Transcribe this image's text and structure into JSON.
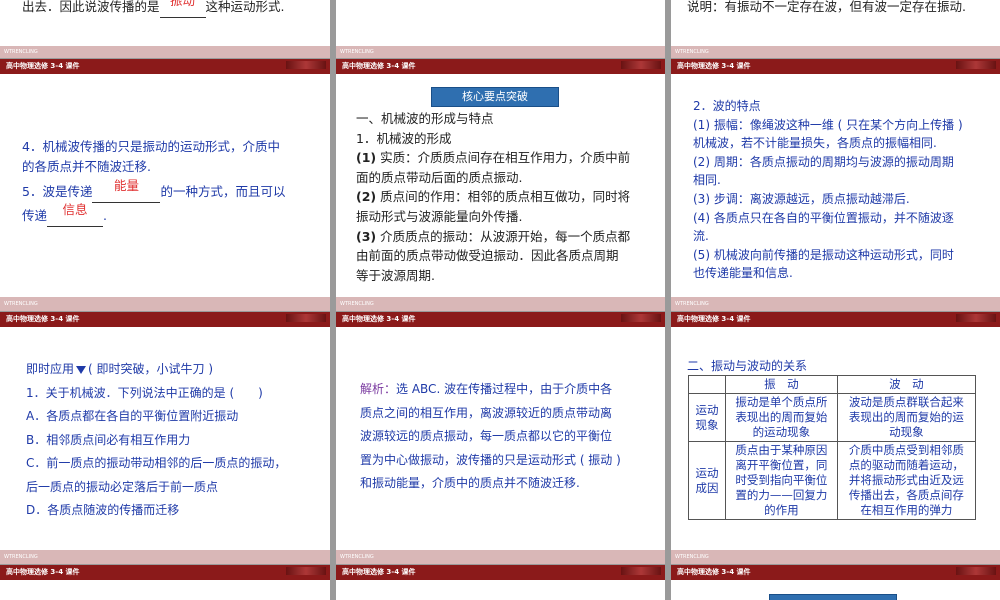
{
  "header_label": "高中物理选修 3-4 课件",
  "strip_label": "WTRENCLING",
  "top_row": {
    "left": {
      "before": "出去．因此说波传播的是",
      "blank": "振动",
      "after": "这种运动形式."
    },
    "right": "说明：有振动不一定存在波，但有波一定存在振动."
  },
  "row2": {
    "left": {
      "item4": "4．机械波传播的只是振动的运动形式，介质中的各质点并不随波迁移.",
      "item4_line1": "4．机械波传播的只是振动的运动形式，介质中",
      "item4_line2": "的各质点并不随波迁移.",
      "item5_before": "5．波是传递",
      "item5_blank1": "能量",
      "item5_mid": "的一种方式，而且可以",
      "item5_line2_before": "传递",
      "item5_blank2": "信息",
      "item5_after": "."
    },
    "middle": {
      "title": "核心要点突破",
      "heading": "一、机械波的形成与特点",
      "sub": "1．机械波的形成",
      "p1_label": "(1)",
      "p1_line1": "实质：介质质点间存在相互作用力，介质中前",
      "p1_line2": "面的质点带动后面的质点振动.",
      "p2_label": "(2)",
      "p2_line1": "质点间的作用：相邻的质点相互做功，同时将",
      "p2_line2": "振动形式与波源能量向外传播.",
      "p3_label": "(3)",
      "p3_line1": "介质质点的振动：从波源开始，每一个质点都",
      "p3_line2": "由前面的质点带动做受迫振动．因此各质点周期",
      "p3_line3": "等于波源周期."
    },
    "right": {
      "heading": "2．波的特点",
      "l1": "(1) 振幅：像绳波这种一维 ( 只在某个方向上传播 )",
      "l2": "机械波，若不计能量损失，各质点的振幅相同.",
      "l3": "(2) 周期：各质点振动的周期均与波源的振动周期",
      "l4": "相同.",
      "l5": "(3) 步调：离波源越远，质点振动越滞后.",
      "l6": "(4) 各质点只在各自的平衡位置振动，并不随波逐",
      "l7": "流.",
      "l8": "(5) 机械波向前传播的是振动这种运动形式，同时",
      "l9": "也传递能量和信息."
    }
  },
  "row3": {
    "left": {
      "intro_a": "即时应用",
      "intro_b": "( 即时突破，小试牛刀 )",
      "q": "1．关于机械波．下列说法中正确的是 (　　)",
      "a": "A．各质点都在各自的平衡位置附近振动",
      "b": "B．相邻质点间必有相互作用力",
      "c1": "C．前一质点的振动带动相邻的后一质点的振动，",
      "c2": "后一质点的振动必定落后于前一质点",
      "d": "D．各质点随波的传播而迁移"
    },
    "middle": {
      "label": "解析：",
      "l1": "选 ABC. 波在传播过程中，由于介质中各",
      "l2": "质点之间的相互作用，离波源较近的质点带动离",
      "l3": "波源较远的质点振动，每一质点都以它的平衡位",
      "l4": "置为中心做振动，波传播的只是运动形式 ( 振动 )",
      "l5": "和振动能量，介质中的质点并不随波迁移."
    },
    "right": {
      "heading": "二、振动与波动的关系",
      "col1": "振　动",
      "col2": "波　动",
      "r1_head_a": "运动",
      "r1_head_b": "现象",
      "r1_c1_a": "振动是单个质点所",
      "r1_c1_b": "表现出的周而复始",
      "r1_c1_c": "的运动现象",
      "r1_c2_a": "波动是质点群联合起来",
      "r1_c2_b": "表现出的周而复始的运",
      "r1_c2_c": "动现象",
      "r2_head_a": "运动",
      "r2_head_b": "成因",
      "r2_c1_a": "质点由于某种原因",
      "r2_c1_b": "离开平衡位置，同",
      "r2_c1_c": "时受到指向平衡位",
      "r2_c1_d": "置的力——回复力",
      "r2_c1_e": "的作用",
      "r2_c2_a": "介质中质点受到相邻质",
      "r2_c2_b": "点的驱动而随着运动，",
      "r2_c2_c": "并将振动形式由近及远",
      "r2_c2_d": "传播出去，各质点间存",
      "r2_c2_e": "在相互作用的弹力"
    }
  }
}
